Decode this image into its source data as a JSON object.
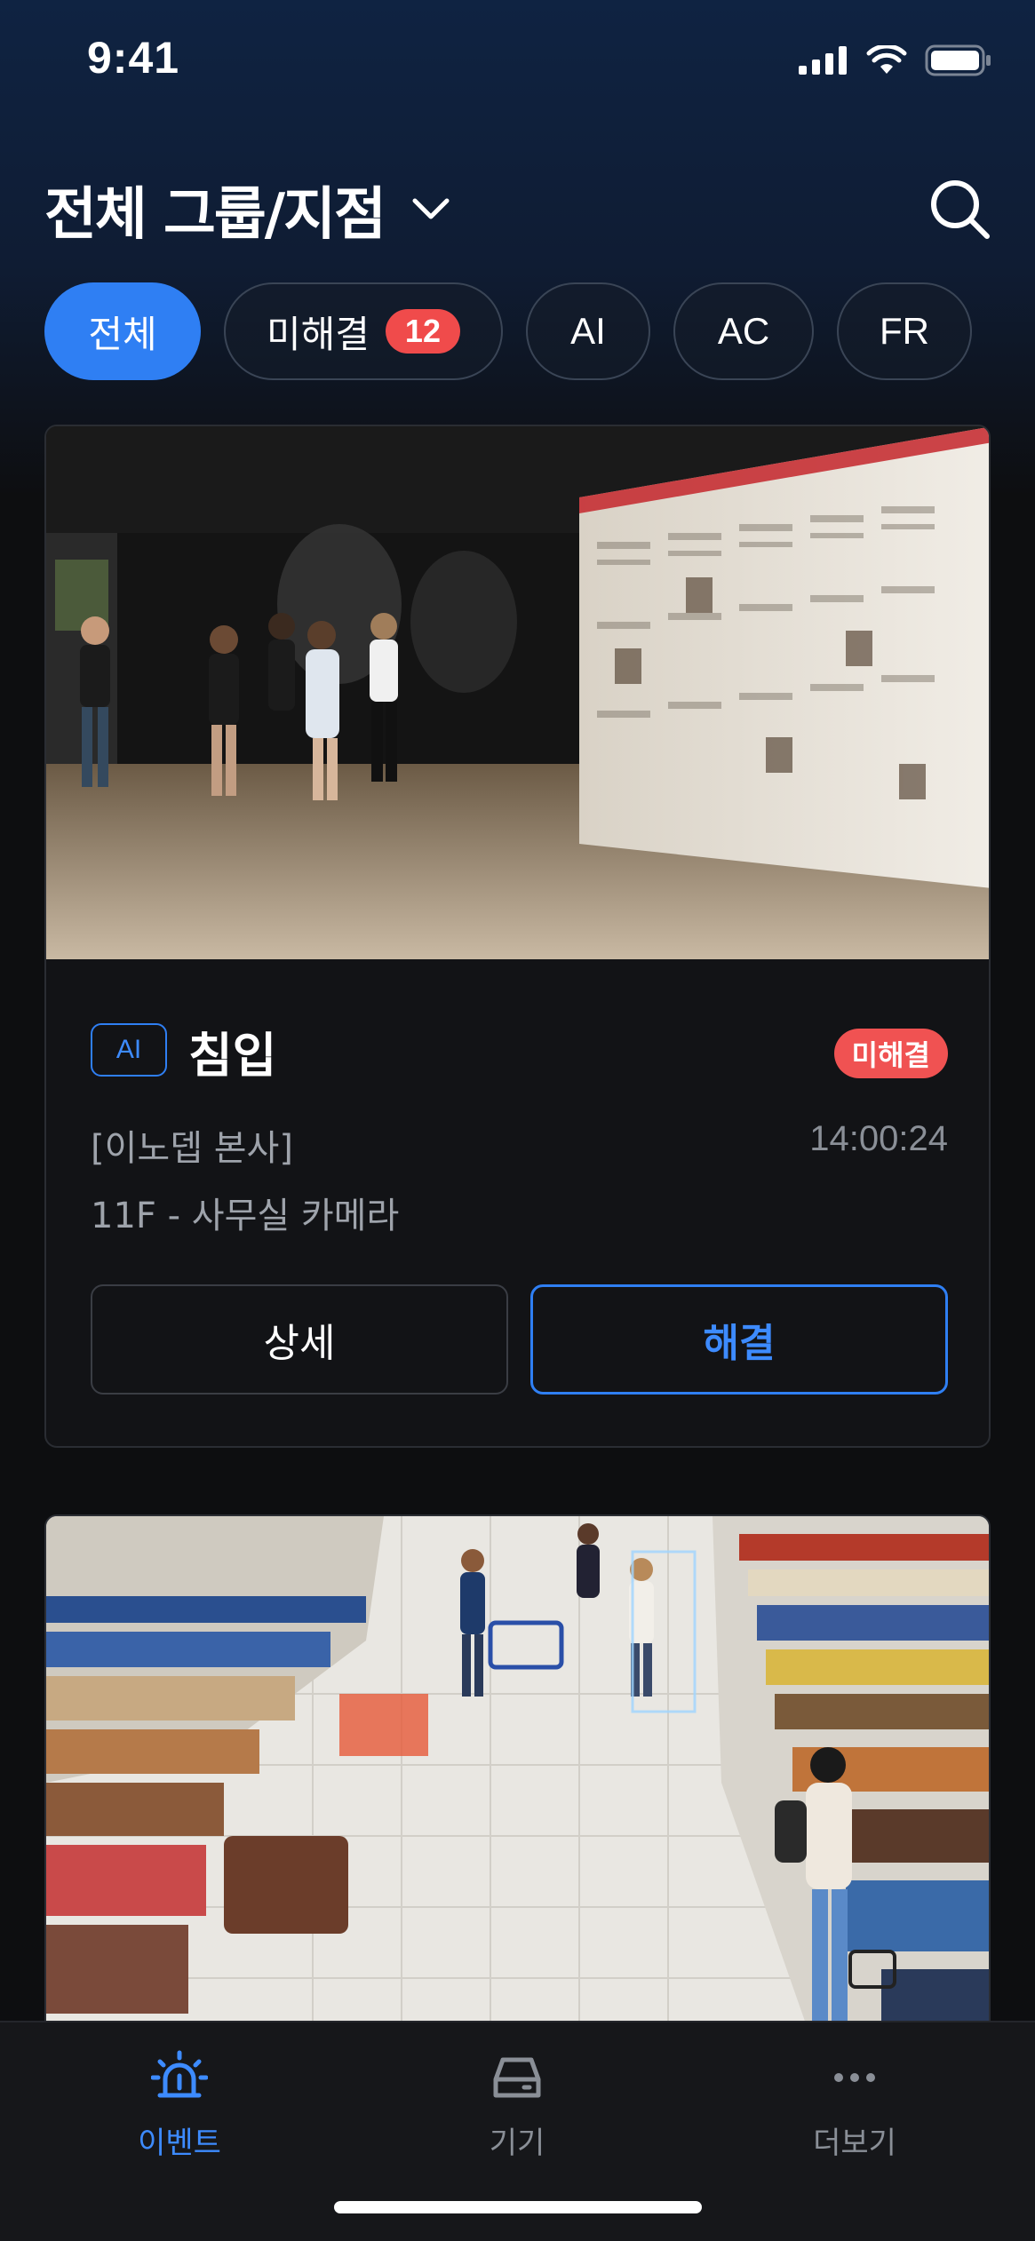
{
  "status_bar": {
    "time": "9:41",
    "icons": [
      "signal-icon",
      "wifi-icon",
      "battery-icon"
    ]
  },
  "header": {
    "title": "전체 그룹/지점",
    "dropdown_icon": "chevron-down-icon",
    "search_icon": "search-icon"
  },
  "filters": {
    "all": "전체",
    "unresolved": "미해결",
    "unresolved_count": "12",
    "ai": "AI",
    "ac": "AC",
    "fr": "FR"
  },
  "events": [
    {
      "tag": "AI",
      "title": "침입",
      "status": "미해결",
      "site": "[이노뎁 본사]",
      "time": "14:00:24",
      "camera": "11F - 사무실 카메라",
      "detail_label": "상세",
      "resolve_label": "해결",
      "image": "gallery-exhibition-photo"
    },
    {
      "image": "supermarket-aisle-photo"
    }
  ],
  "tabbar": {
    "events": "이벤트",
    "devices": "기기",
    "more": "더보기"
  },
  "colors": {
    "accent": "#2f7ff3",
    "danger": "#f04b4b",
    "background": "#0d0e10"
  }
}
